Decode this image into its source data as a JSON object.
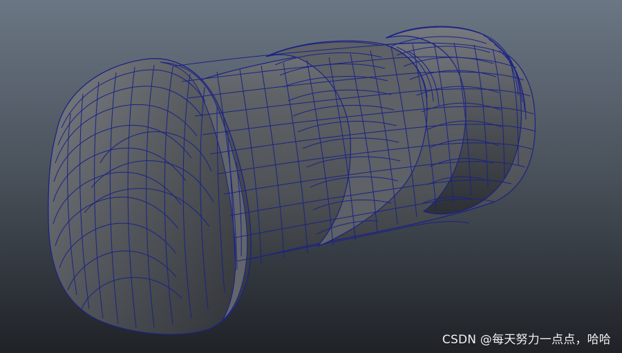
{
  "viewport": {
    "name": "3D modeling viewport",
    "object": "wireframe-on-shaded cylindrical mesh"
  },
  "watermark": {
    "text": "CSDN @每天努力一点点，哈哈"
  },
  "colors": {
    "background_top": "#6b7684",
    "background_bottom": "#1f2227",
    "mesh_fill": "#55585c",
    "mesh_fill_light": "#6e7175",
    "mesh_fill_dark": "#34373a",
    "wire": "#1a2286"
  }
}
